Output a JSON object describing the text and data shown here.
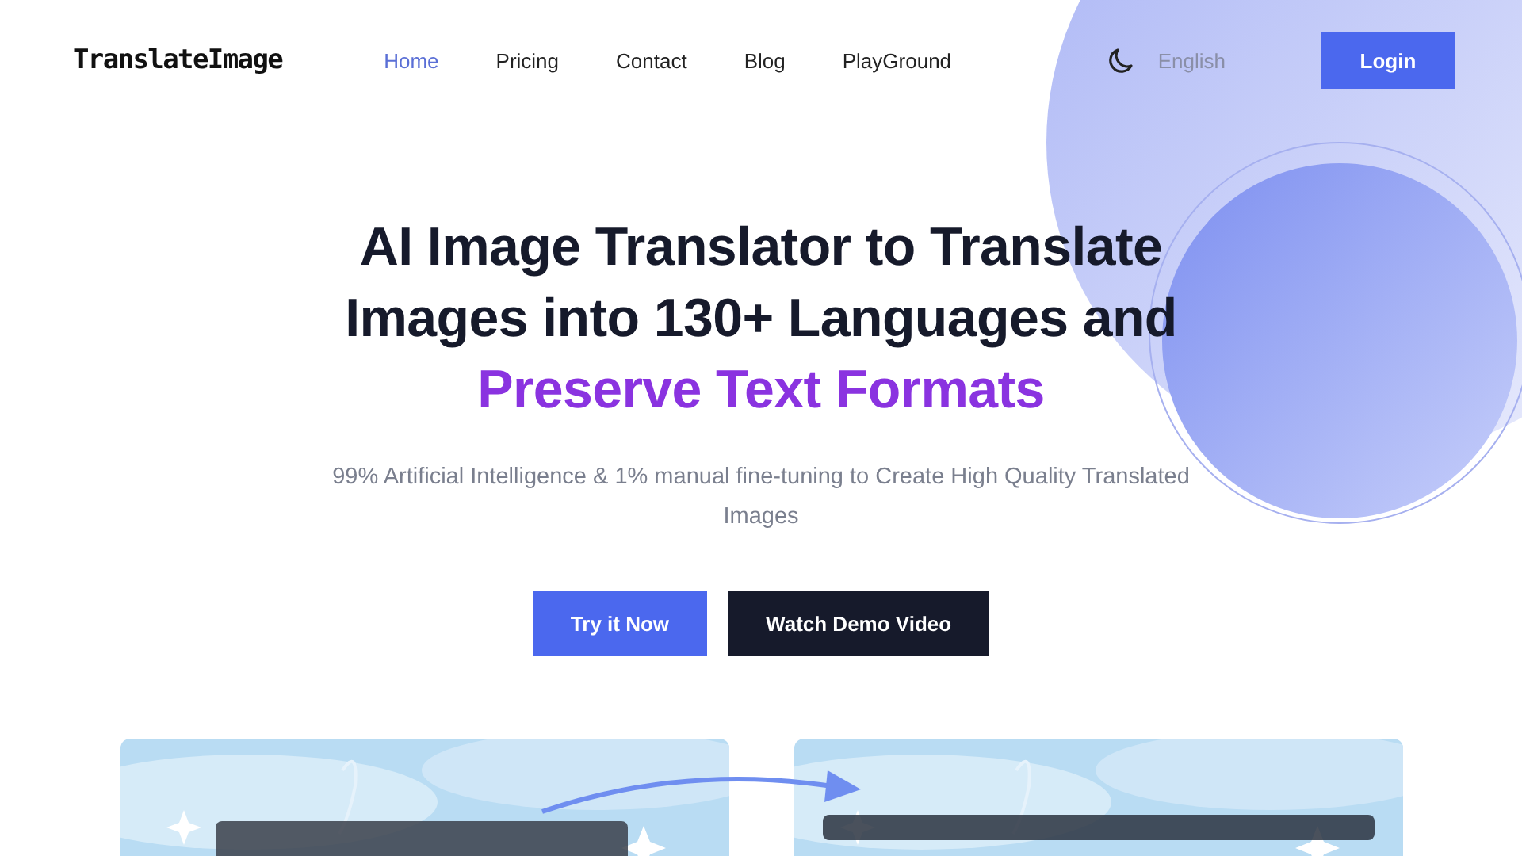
{
  "logo": "TranslateImage",
  "nav": [
    {
      "label": "Home",
      "selected": true
    },
    {
      "label": "Pricing",
      "selected": false
    },
    {
      "label": "Contact",
      "selected": false
    },
    {
      "label": "Blog",
      "selected": false
    },
    {
      "label": "PlayGround",
      "selected": false
    }
  ],
  "language": "English",
  "login": "Login",
  "hero": {
    "title_lines": [
      "AI Image Translator to Translate",
      "Images into 130+ Languages and"
    ],
    "title_highlight": "Preserve Text Formats",
    "subtitle": "99% Artificial Intelligence & 1% manual fine-tuning to Create High Quality Translated Images"
  },
  "buttons": [
    {
      "label": "Try it Now",
      "kind": "primary"
    },
    {
      "label": "Watch Demo Video",
      "kind": "dark"
    }
  ]
}
